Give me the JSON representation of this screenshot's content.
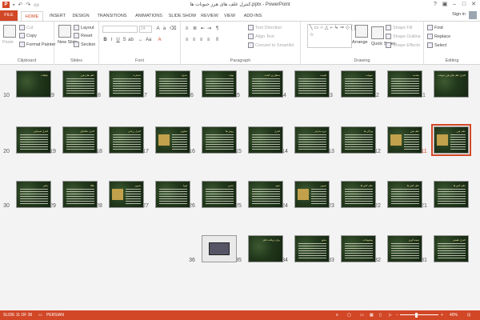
{
  "titlebar": {
    "title": "کنترل علف های هرز حبوبات ها.pptx - PowerPoint",
    "app_icon": "P",
    "qat": [
      "save-icon",
      "undo-icon",
      "redo-icon",
      "present-icon"
    ]
  },
  "tabs": {
    "items": [
      "FILE",
      "HOME",
      "INSERT",
      "DESIGN",
      "TRANSITIONS",
      "ANIMATIONS",
      "SLIDE SHOW",
      "REVIEW",
      "VIEW",
      "ADD-INS"
    ],
    "active": "HOME",
    "signin": "Sign in"
  },
  "ribbon": {
    "clipboard": {
      "label": "Clipboard",
      "paste": "Paste",
      "cut": "Cut",
      "copy": "Copy",
      "format_painter": "Format Painter"
    },
    "slides": {
      "label": "Slides",
      "new_slide": "New Slide",
      "layout": "Layout",
      "reset": "Reset",
      "section": "Section"
    },
    "font": {
      "label": "Font",
      "size": "24"
    },
    "paragraph": {
      "label": "Paragraph",
      "text_direction": "Text Direction",
      "align_text": "Align Text",
      "convert_smartart": "Convert to SmartArt"
    },
    "drawing": {
      "label": "Drawing",
      "arrange": "Arrange",
      "quick_styles": "Quick Styles",
      "shape_fill": "Shape Fill",
      "shape_outline": "Shape Outline",
      "shape_effects": "Shape Effects"
    },
    "editing": {
      "label": "Editing",
      "find": "Find",
      "replace": "Replace",
      "select": "Select"
    }
  },
  "slides": [
    {
      "n": "1",
      "title": "کنترل علف های هرز حبوبات",
      "kind": "title"
    },
    {
      "n": "2",
      "title": "مقدمه",
      "kind": "text"
    },
    {
      "n": "3",
      "title": "حبوبات",
      "kind": "text"
    },
    {
      "n": "4",
      "title": "اهمیت",
      "kind": "text"
    },
    {
      "n": "5",
      "title": "سطح زیر کشت",
      "kind": "text"
    },
    {
      "n": "6",
      "title": "تولید",
      "kind": "text"
    },
    {
      "n": "7",
      "title": "جدول",
      "kind": "table"
    },
    {
      "n": "8",
      "title": "خسارت",
      "kind": "text"
    },
    {
      "n": "9",
      "title": "علف های هرز",
      "kind": "text"
    },
    {
      "n": "10",
      "title": "تبلیغات",
      "kind": "title"
    },
    {
      "n": "11",
      "title": "علف هرز",
      "kind": "picture",
      "selected": true
    },
    {
      "n": "12",
      "title": "علف هرز",
      "kind": "picture"
    },
    {
      "n": "13",
      "title": "ویژگی ها",
      "kind": "text"
    },
    {
      "n": "14",
      "title": "دوره بحرانی",
      "kind": "text"
    },
    {
      "n": "15",
      "title": "کنترل",
      "kind": "text"
    },
    {
      "n": "16",
      "title": "روش ها",
      "kind": "text"
    },
    {
      "n": "17",
      "title": "تصاویر",
      "kind": "picture"
    },
    {
      "n": "18",
      "title": "کنترل زراعی",
      "kind": "text"
    },
    {
      "n": "19",
      "title": "کنترل مکانیکی",
      "kind": "text"
    },
    {
      "n": "20",
      "title": "کنترل شیمیایی",
      "kind": "text"
    },
    {
      "n": "21",
      "title": "علف کش ها",
      "kind": "text"
    },
    {
      "n": "22",
      "title": "علف کش ها",
      "kind": "text"
    },
    {
      "n": "23",
      "title": "علف کش ها",
      "kind": "text"
    },
    {
      "n": "24",
      "title": "تصویر",
      "kind": "picture"
    },
    {
      "n": "25",
      "title": "نخود",
      "kind": "text"
    },
    {
      "n": "26",
      "title": "عدس",
      "kind": "text"
    },
    {
      "n": "27",
      "title": "لوبیا",
      "kind": "text"
    },
    {
      "n": "28",
      "title": "تصویر",
      "kind": "picture"
    },
    {
      "n": "29",
      "title": "باقلا",
      "kind": "text"
    },
    {
      "n": "30",
      "title": "ماش",
      "kind": "text"
    },
    {
      "n": "31",
      "title": "کنترل تلفیقی",
      "kind": "text"
    },
    {
      "n": "32",
      "title": "نتیجه گیری",
      "kind": "text"
    },
    {
      "n": "33",
      "title": "پیشنهادات",
      "kind": "text"
    },
    {
      "n": "34",
      "title": "منابع",
      "kind": "text"
    },
    {
      "n": "35",
      "title": "برای دریافت فایل",
      "kind": "title"
    },
    {
      "n": "36",
      "title": "",
      "kind": "laptop"
    }
  ],
  "status": {
    "slide_info": "SLIDE 11 OF 36",
    "language": "PERSIAN",
    "zoom": "40%",
    "minus": "−",
    "plus": "+",
    "accent": "#d24726"
  }
}
